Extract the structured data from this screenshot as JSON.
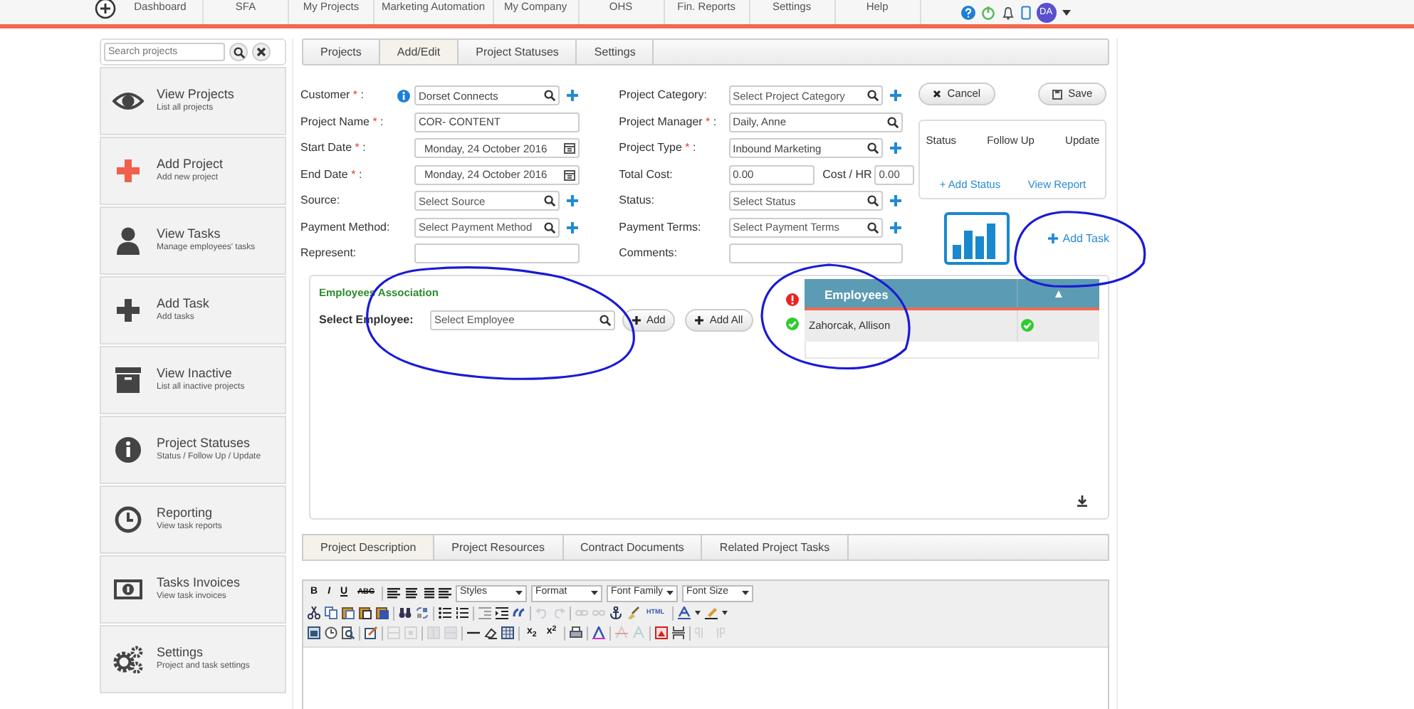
{
  "top_nav": {
    "items": [
      {
        "label": "Dashboard"
      },
      {
        "label": "SFA"
      },
      {
        "label": "My Projects"
      },
      {
        "label": "Marketing Automation"
      },
      {
        "label": "My Company"
      },
      {
        "label": "OHS"
      },
      {
        "label": "Fin. Reports"
      },
      {
        "label": "Settings"
      },
      {
        "label": "Help"
      }
    ],
    "avatar": "DA"
  },
  "sidebar": {
    "search": {
      "placeholder": "Search projects"
    },
    "items": [
      {
        "kind": "eye",
        "title": "View Projects",
        "subtitle": "List all projects"
      },
      {
        "kind": "add-project",
        "title": "Add Project",
        "subtitle": "Add new project"
      },
      {
        "kind": "user",
        "title": "View Tasks",
        "subtitle": "Manage employees' tasks"
      },
      {
        "kind": "add-task",
        "title": "Add Task",
        "subtitle": "Add tasks"
      },
      {
        "kind": "archive",
        "title": "View Inactive",
        "subtitle": "List all inactive projects"
      },
      {
        "kind": "info",
        "title": "Project Statuses",
        "subtitle": "Status / Follow Up / Update"
      },
      {
        "kind": "clock",
        "title": "Reporting",
        "subtitle": "View task reports"
      },
      {
        "kind": "invoice",
        "title": "Tasks Invoices",
        "subtitle": "View task invoices"
      },
      {
        "kind": "gears",
        "title": "Settings",
        "subtitle": "Project and task settings"
      }
    ]
  },
  "tabs": [
    {
      "label": "Projects",
      "selected": false
    },
    {
      "label": "Add/Edit",
      "selected": true
    },
    {
      "label": "Project Statuses",
      "selected": false
    },
    {
      "label": "Settings",
      "selected": false
    }
  ],
  "form": {
    "left": [
      {
        "kind": "lookup",
        "label": "Customer",
        "required_mark": "*",
        "label_end": ":",
        "info": true,
        "value": "Dorset Connects",
        "add": true
      },
      {
        "kind": "text",
        "label": "Project Name",
        "required_mark": "*",
        "label_end": ":",
        "value": "COR- CONTENT"
      },
      {
        "kind": "date",
        "label": "Start Date",
        "required_mark": "*",
        "label_end": ":",
        "value": "Monday, 24 October 2016"
      },
      {
        "kind": "date",
        "label": "End Date",
        "required_mark": "*",
        "label_end": ":",
        "value": "Monday, 24 October 2016"
      },
      {
        "kind": "lookup",
        "label": "Source:",
        "placeholder": "Select Source",
        "add": true
      },
      {
        "kind": "lookup",
        "label": "Payment Method:",
        "placeholder": "Select Payment Method",
        "add": true
      },
      {
        "kind": "text",
        "label": "Represent:"
      }
    ],
    "right": [
      {
        "kind": "lookup",
        "label": "Project Category:",
        "placeholder": "Select Project Category",
        "add": true
      },
      {
        "kind": "lookup",
        "label": "Project Manager",
        "required_mark": "*",
        "label_end": ":",
        "value": "Daily, Anne",
        "add": false
      },
      {
        "kind": "lookup",
        "label": "Project Type",
        "required_mark": "*",
        "label_end": ":",
        "value": "Inbound Marketing",
        "add": true
      },
      {
        "kind": "cost",
        "label": "Total Cost:",
        "value": "0.00",
        "second_label": "Cost / HR",
        "second_value": "0.00"
      },
      {
        "kind": "lookup",
        "label": "Status:",
        "placeholder": "Select Status",
        "add": true
      },
      {
        "kind": "lookup",
        "label": "Payment Terms:",
        "placeholder": "Select Payment Terms",
        "add": true
      },
      {
        "kind": "text",
        "label": "Comments:"
      }
    ]
  },
  "actions": [
    {
      "kind": "cancel",
      "label": "Cancel"
    },
    {
      "kind": "save",
      "label": "Save"
    }
  ],
  "status_panel": {
    "columns": [
      "Status",
      "Follow Up",
      "Update"
    ],
    "links": [
      "+ Add Status",
      "View Report"
    ]
  },
  "add_task": "Add Task",
  "employees": {
    "title": "Employees Association",
    "label": "Select Employee:",
    "placeholder": "Select Employee",
    "buttons": [
      "Add",
      "Add All"
    ],
    "table": {
      "columns": [
        "Employees",
        "▲"
      ],
      "rows": [
        {
          "name": "Zahorcak, Allison",
          "ok": true
        }
      ]
    }
  },
  "bottom_tabs": [
    {
      "label": "Project Description",
      "selected": true
    },
    {
      "label": "Project Resources",
      "selected": false
    },
    {
      "label": "Contract Documents",
      "selected": false
    },
    {
      "label": "Related Project Tasks",
      "selected": false
    }
  ],
  "editor": {
    "format_buttons": [
      "B",
      "I",
      "U",
      "ABC"
    ],
    "selects": [
      "Styles",
      "Format",
      "Font Family",
      "Font Size"
    ],
    "html_button": "HTML",
    "script_buttons": [
      "x$_{2}$",
      "x$^{2}$"
    ]
  }
}
